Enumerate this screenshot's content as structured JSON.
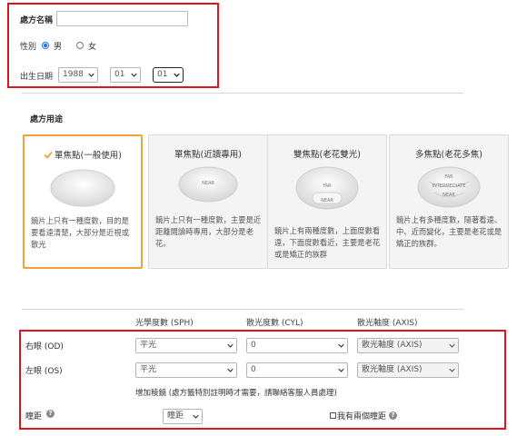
{
  "basic": {
    "name_label": "處方名稱",
    "name_value": "",
    "gender_label": "性別",
    "gender_options": [
      {
        "label": "男",
        "checked": true
      },
      {
        "label": "女",
        "checked": false
      }
    ],
    "birth_label": "出生日期",
    "birth_year": "1988",
    "birth_month": "01",
    "birth_day": "01"
  },
  "usage": {
    "section_title": "處方用途",
    "cards": [
      {
        "title": "單焦點(一般使用)",
        "selected": true,
        "desc": "鏡片上只有一種度數，目的是要看遠清楚，大部分是近視或散光",
        "lens_tags": []
      },
      {
        "title": "單焦點(近讀專用)",
        "selected": false,
        "desc": "鏡片上只有一種度數，主要是近距離閱讀時專用，大部分是老花。",
        "lens_tags": [
          "NEAR"
        ]
      },
      {
        "title": "雙焦點(老花雙光)",
        "selected": false,
        "desc": "鏡片上有兩種度數，上面度數看遠，下面度數看近，主要是老花或是矯正的族群",
        "lens_tags": [
          "FAR",
          "NEAR"
        ]
      },
      {
        "title": "多焦點(老花多焦)",
        "selected": false,
        "desc": "鏡片上有多種度數，隨著看遠、中、近而變化，主要是老花或是矯正的族群。",
        "lens_tags": [
          "FAR",
          "INTERMEDIATE",
          "NEAR"
        ]
      }
    ]
  },
  "prescription": {
    "col_sph": "光學度數 (SPH)",
    "col_cyl": "散光度數 (CYL)",
    "col_axis": "散光軸度 (AXIS)",
    "rows": [
      {
        "label": "右眼 (OD)",
        "sph": "平光",
        "cyl": "0",
        "axis": "散光軸度 (AXIS)"
      },
      {
        "label": "左眼 (OS)",
        "sph": "平光",
        "cyl": "0",
        "axis": "散光軸度 (AXIS)"
      }
    ],
    "prism_note": "增加稜鏡 (處方籤特別註明時才需要，請聯絡客服人員處理)",
    "pd_label": "瞳距",
    "pd_select": "瞳距",
    "two_pd_label": "我有兩個瞳距"
  },
  "colors": {
    "annotation_red": "#e0141c",
    "selected_border": "#f0a334",
    "radio_blue": "#1b73e8"
  }
}
